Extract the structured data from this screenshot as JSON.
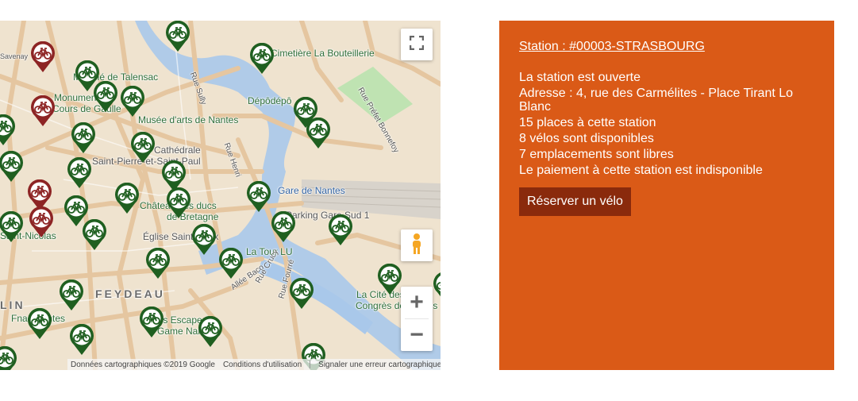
{
  "map": {
    "labels": {
      "savenay": "Savenay",
      "talensac": "Marché de Talensac",
      "cimetiere": "Cimetière La Bouteillerie",
      "monument": "Monument",
      "gaulle": "Cours de Gaulle",
      "depot": "Dépôdépô",
      "musee": "Musée d'arts de Nantes",
      "cathedrale": "Cathédrale",
      "saint_pierre": "Saint-Pierre-et-Saint-Paul",
      "rue_sully": "Rue Sully",
      "rue_henri": "Rue Henri",
      "rue_prefet": "Rue Préfet Bonnefoy",
      "gare": "Gare de Nantes",
      "chateau_1": "Château des ducs",
      "chateau_2": "de Bretagne",
      "parking": "Parking Gare Sud 1",
      "saint_nicolas": "Saint-Nicolas",
      "eglise": "Église Saint-Croix",
      "tour_lu": "La Tour LU",
      "feydeau": "FEYDEAU",
      "allee": "Allée Baco",
      "rue_crucy": "Rue Crucy",
      "rue_fourre": "Rue Fourré",
      "cite_1": "La Cité des",
      "cite_2": "Congrès de Nantes",
      "lin": "LIN",
      "fna": "Fnac Nantes",
      "escape_1": "Jobs Escape",
      "escape_2": "Game Nantes"
    },
    "attribution": {
      "data": "Données cartographiques ©2019 Google",
      "terms": "Conditions d'utilisation",
      "report": "Signaler une erreur cartographique"
    },
    "zoom_in": "+",
    "zoom_out": "−"
  },
  "station": {
    "title": "Station : #00003-STRASBOURG",
    "status": "La station est ouverte",
    "address": "Adresse : 4, rue des Carmélites - Place Tirant Lo Blanc",
    "places": "15 places à cette station",
    "bikes": "8 vélos sont disponibles",
    "free": "7 emplacements sont libres",
    "payment": "Le paiement à cette station est indisponible",
    "reserve_label": "Réserver un vélo"
  },
  "colors": {
    "panel_bg": "#da5a17",
    "button_bg": "#8a2a0c",
    "marker_green": "#1f5f20",
    "marker_red": "#8d2424"
  },
  "icons": {
    "marker": "bike-marker-icon",
    "fullscreen": "fullscreen-icon",
    "pegman": "pegman-icon"
  }
}
